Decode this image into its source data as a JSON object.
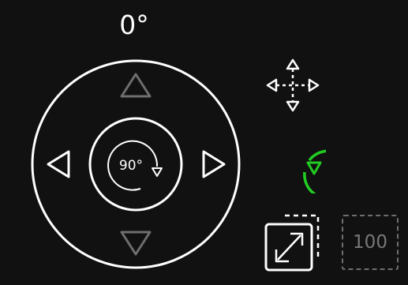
{
  "rotation": {
    "angle_label": "0°",
    "step_label": "90°"
  },
  "zoom": {
    "value_label": "100"
  },
  "colors": {
    "background": "#111111",
    "foreground": "#ffffff",
    "disabled": "#6e6e6e",
    "accent_green": "#22cc22"
  },
  "icons": {
    "move": "move-arrows-icon",
    "rotate": "rotate-clockwise-icon",
    "fit": "fit-screen-icon"
  }
}
